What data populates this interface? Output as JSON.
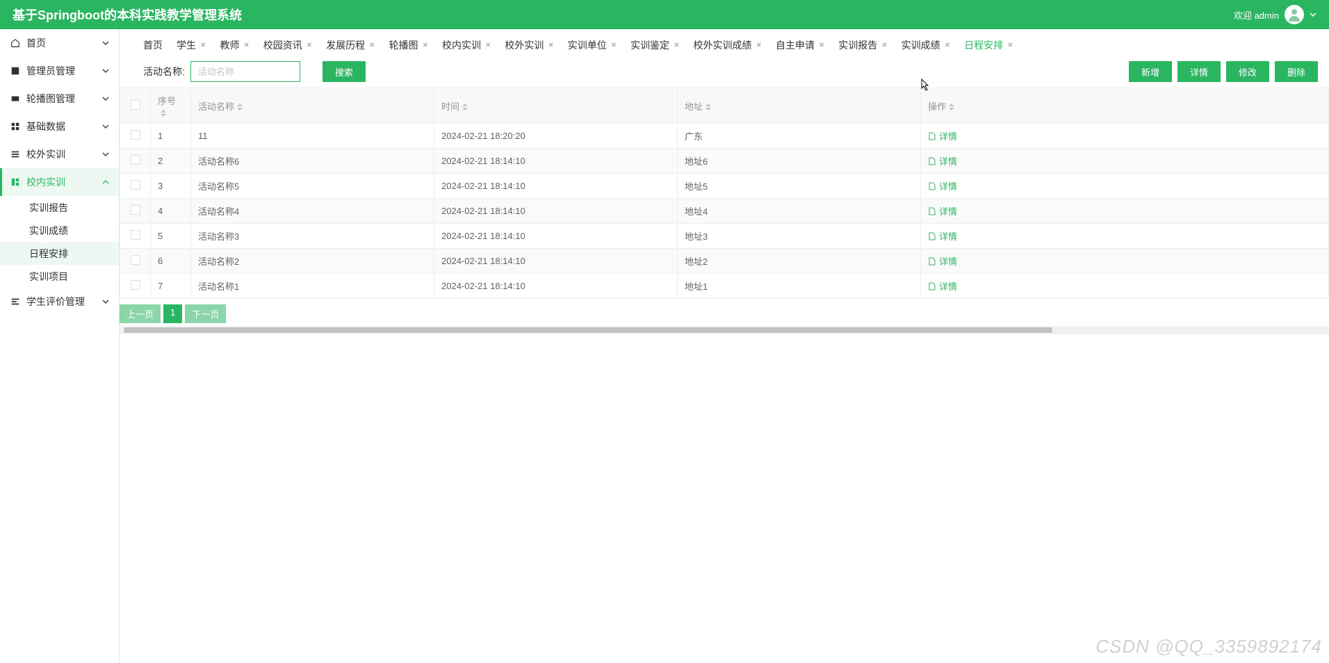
{
  "header": {
    "title": "基于Springboot的本科实践教学管理系统",
    "welcome": "欢迎 admin"
  },
  "sidebar": [
    {
      "icon": "home",
      "label": "首页",
      "expand": true
    },
    {
      "icon": "admin",
      "label": "管理员管理",
      "expand": true
    },
    {
      "icon": "carousel",
      "label": "轮播图管理",
      "expand": true
    },
    {
      "icon": "base",
      "label": "基础数据",
      "expand": true
    },
    {
      "icon": "external",
      "label": "校外实训",
      "expand": true
    },
    {
      "icon": "internal",
      "label": "校内实训",
      "expand": true,
      "active": true,
      "children": [
        {
          "label": "实训报告"
        },
        {
          "label": "实训成绩"
        },
        {
          "label": "日程安排",
          "active": true
        },
        {
          "label": "实训项目"
        }
      ]
    },
    {
      "icon": "eval",
      "label": "学生评价管理",
      "expand": true
    }
  ],
  "tabs": [
    {
      "label": "首页",
      "closable": false
    },
    {
      "label": "学生",
      "closable": true
    },
    {
      "label": "教师",
      "closable": true
    },
    {
      "label": "校园资讯",
      "closable": true
    },
    {
      "label": "发展历程",
      "closable": true
    },
    {
      "label": "轮播图",
      "closable": true
    },
    {
      "label": "校内实训",
      "closable": true
    },
    {
      "label": "校外实训",
      "closable": true
    },
    {
      "label": "实训单位",
      "closable": true
    },
    {
      "label": "实训鉴定",
      "closable": true
    },
    {
      "label": "校外实训成绩",
      "closable": true
    },
    {
      "label": "自主申请",
      "closable": true
    },
    {
      "label": "实训报告",
      "closable": true
    },
    {
      "label": "实训成绩",
      "closable": true
    },
    {
      "label": "日程安排",
      "closable": true,
      "active": true
    }
  ],
  "toolbar": {
    "search_label": "活动名称:",
    "search_placeholder": "活动名称",
    "search_btn": "搜索",
    "add_btn": "新增",
    "detail_btn": "详情",
    "edit_btn": "修改",
    "delete_btn": "删除"
  },
  "table": {
    "columns": {
      "seq": "序号",
      "name": "活动名称",
      "time": "时间",
      "addr": "地址",
      "op": "操作"
    },
    "detail_label": "详情",
    "rows": [
      {
        "seq": "1",
        "name": "11",
        "time": "2024-02-21 18:20:20",
        "addr": "广东"
      },
      {
        "seq": "2",
        "name": "活动名称6",
        "time": "2024-02-21 18:14:10",
        "addr": "地址6"
      },
      {
        "seq": "3",
        "name": "活动名称5",
        "time": "2024-02-21 18:14:10",
        "addr": "地址5"
      },
      {
        "seq": "4",
        "name": "活动名称4",
        "time": "2024-02-21 18:14:10",
        "addr": "地址4"
      },
      {
        "seq": "5",
        "name": "活动名称3",
        "time": "2024-02-21 18:14:10",
        "addr": "地址3"
      },
      {
        "seq": "6",
        "name": "活动名称2",
        "time": "2024-02-21 18:14:10",
        "addr": "地址2"
      },
      {
        "seq": "7",
        "name": "活动名称1",
        "time": "2024-02-21 18:14:10",
        "addr": "地址1"
      }
    ]
  },
  "pagination": {
    "prev": "上一页",
    "page": "1",
    "next": "下一页"
  },
  "watermark": "CSDN @QQ_3359892174"
}
